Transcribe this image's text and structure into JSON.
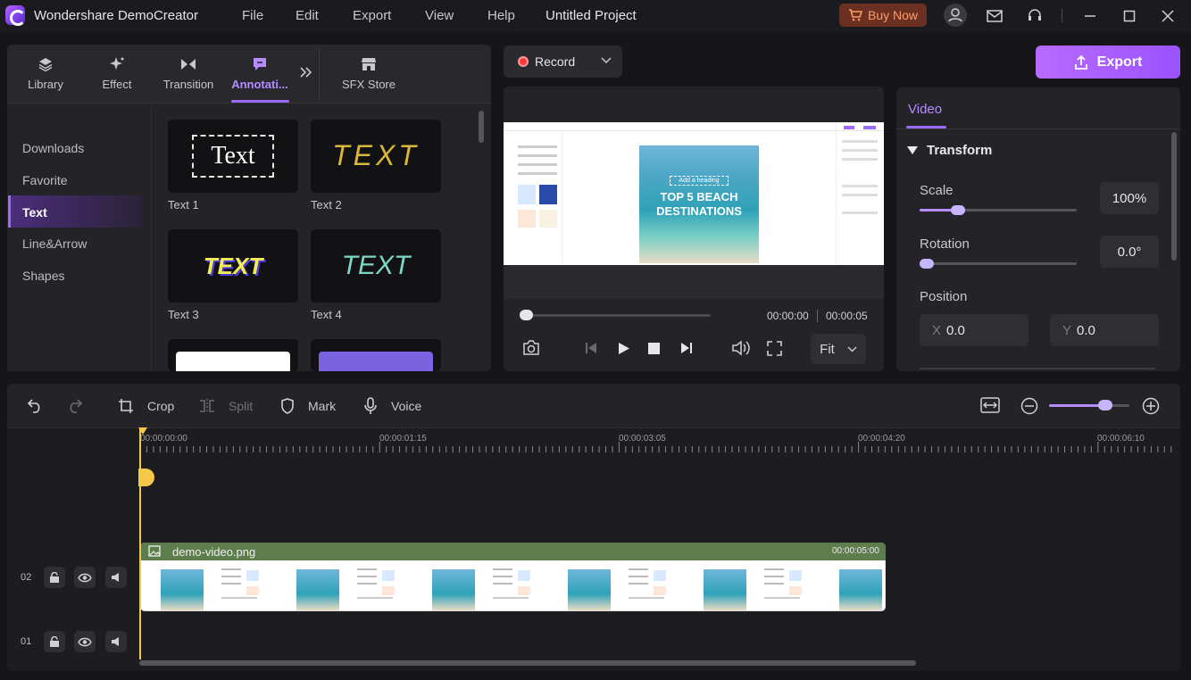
{
  "app": {
    "name": "Wondershare DemoCreator",
    "menu": [
      "File",
      "Edit",
      "Export",
      "View",
      "Help"
    ],
    "project_title": "Untitled Project",
    "buy_now": "Buy Now"
  },
  "left_panel": {
    "tabs": [
      {
        "label": "Library",
        "icon": "layers-icon"
      },
      {
        "label": "Effect",
        "icon": "sparkle-icon"
      },
      {
        "label": "Transition",
        "icon": "transition-icon"
      },
      {
        "label": "Annotati...",
        "icon": "annotation-icon"
      },
      {
        "label": "SFX Store",
        "icon": "store-icon"
      }
    ],
    "sidebar": [
      "Downloads",
      "Favorite",
      "Text",
      "Line&Arrow",
      "Shapes"
    ],
    "templates": [
      {
        "label": "Text 1",
        "preview": "Text"
      },
      {
        "label": "Text 2",
        "preview": "TEXT"
      },
      {
        "label": "Text 3",
        "preview": "TEXT"
      },
      {
        "label": "Text 4",
        "preview": "TEXT"
      }
    ]
  },
  "record": {
    "label": "Record"
  },
  "preview": {
    "current_time": "00:00:00",
    "total_time": "00:00:05",
    "fit_label": "Fit",
    "canvas": {
      "heading_box": "Add a heading",
      "title_line1": "TOP 5 BEACH",
      "title_line2": "DESTINATIONS"
    }
  },
  "export": {
    "label": "Export"
  },
  "properties": {
    "tab": "Video",
    "section": "Transform",
    "scale": {
      "label": "Scale",
      "value": "100%",
      "level": 0.22
    },
    "rotation": {
      "label": "Rotation",
      "value": "0.0°",
      "level": 0.0
    },
    "position": {
      "label": "Position",
      "x_label": "X",
      "x": "0.0",
      "y_label": "Y",
      "y": "0.0"
    }
  },
  "timeline": {
    "tools": [
      "Crop",
      "Split",
      "Mark",
      "Voice"
    ],
    "ruler_labels": [
      "00:00:00:00",
      "00:00:01:15",
      "00:00:03:05",
      "00:00:04:20",
      "00:00:06:10"
    ],
    "tracks": [
      {
        "num": "02"
      },
      {
        "num": "01"
      }
    ],
    "clip": {
      "name": "demo-video.png",
      "duration": "00:00:05:00"
    },
    "zoom_level": 0.7
  },
  "colors": {
    "accent": "#9b6bff",
    "record": "#ff3b3b",
    "playhead": "#f5c84a",
    "clip_header": "#5d7d4c",
    "buy_now": "#ff9a63"
  }
}
